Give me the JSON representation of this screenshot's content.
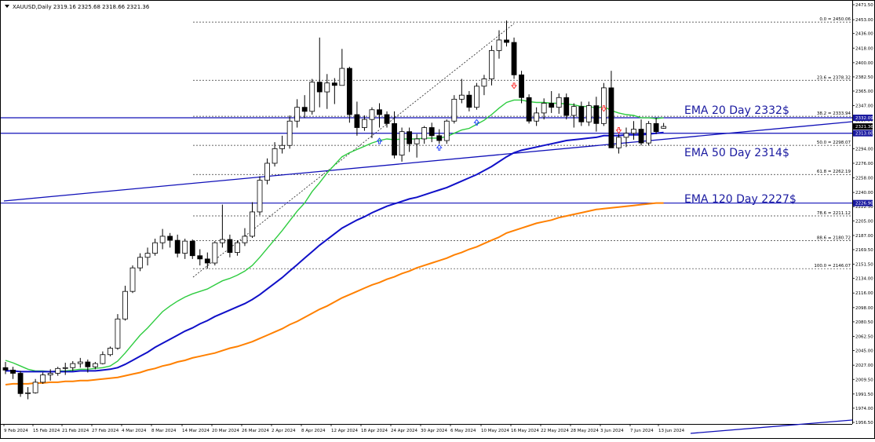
{
  "chart_data": {
    "type": "candlestick",
    "symbol_header": "XAUUSD,Daily  2319.16 2325.68 2318.66 2321.36",
    "y_ticks": [
      "2471.50",
      "2453.00",
      "2436.00",
      "2418.00",
      "2400.00",
      "2382.50",
      "2365.00",
      "2347.00",
      "2329.50",
      "2312.00",
      "2294.00",
      "2276.00",
      "2258.00",
      "2240.00",
      "2222.50",
      "2205.00",
      "2187.00",
      "2169.50",
      "2151.50",
      "2134.00",
      "2116.00",
      "2098.00",
      "2080.50",
      "2062.50",
      "2045.00",
      "2027.00",
      "2009.50",
      "1991.50",
      "1974.00",
      "1956.50"
    ],
    "x_ticks": [
      "9 Feb 2024",
      "15 Feb 2024",
      "21 Feb 2024",
      "27 Feb 2024",
      "4 Mar 2024",
      "8 Mar 2024",
      "14 Mar 2024",
      "20 Mar 2024",
      "26 Mar 2024",
      "2 Apr 2024",
      "8 Apr 2024",
      "12 Apr 2024",
      "18 Apr 2024",
      "24 Apr 2024",
      "30 Apr 2024",
      "6 May 2024",
      "10 May 2024",
      "16 May 2024",
      "22 May 2024",
      "28 May 2024",
      "3 Jun 2024",
      "7 Jun 2024",
      "13 Jun 2024"
    ],
    "price_tags": [
      {
        "text": "2332.09",
        "value": 2332.09,
        "bg": "#1a1aa0"
      },
      {
        "text": "2321.36",
        "value": 2321.36,
        "bg": "#000000"
      },
      {
        "text": "2313.00",
        "value": 2313.0,
        "bg": "#1a1aa0"
      },
      {
        "text": "2226.90",
        "value": 2226.9,
        "bg": "#1a1aa0"
      }
    ],
    "fib_levels": [
      {
        "label": "0.0 = 2450.06",
        "value": 2450.06
      },
      {
        "label": "23.6 = 2378.32",
        "value": 2378.32
      },
      {
        "label": "38.2 = 2333.94",
        "value": 2333.94
      },
      {
        "label": "50.0 = 2298.07",
        "value": 2298.07
      },
      {
        "label": "61.8 = 2262.19",
        "value": 2262.19
      },
      {
        "label": "78.6 = 2211.12",
        "value": 2211.12
      },
      {
        "label": "88.6 = 2180.72",
        "value": 2180.72
      },
      {
        "label": "100.0 = 2146.07",
        "value": 2146.07
      }
    ],
    "horizontal_lines": [
      2332.09,
      2313.0,
      2226.9
    ],
    "annotations": [
      {
        "text": "EMA 20 Day  2332$"
      },
      {
        "text": "EMA 50 Day  2314$"
      },
      {
        "text": "EMA 120 Day  2227$"
      }
    ],
    "candles": [
      [
        2024,
        2031,
        2016,
        2021
      ],
      [
        2021,
        2025,
        2010,
        2017
      ],
      [
        2017,
        2020,
        1988,
        1992
      ],
      [
        1992,
        2000,
        1985,
        1993
      ],
      [
        1993,
        2010,
        1992,
        2006
      ],
      [
        2006,
        2018,
        2004,
        2015
      ],
      [
        2015,
        2022,
        2008,
        2017
      ],
      [
        2017,
        2025,
        2014,
        2023
      ],
      [
        2023,
        2030,
        2015,
        2024
      ],
      [
        2024,
        2032,
        2020,
        2029
      ],
      [
        2029,
        2036,
        2024,
        2031
      ],
      [
        2031,
        2034,
        2018,
        2025
      ],
      [
        2025,
        2031,
        2022,
        2029
      ],
      [
        2029,
        2044,
        2028,
        2040
      ],
      [
        2040,
        2050,
        2038,
        2048
      ],
      [
        2048,
        2090,
        2046,
        2084
      ],
      [
        2084,
        2125,
        2082,
        2118
      ],
      [
        2118,
        2150,
        2116,
        2147
      ],
      [
        2147,
        2165,
        2143,
        2160
      ],
      [
        2160,
        2172,
        2150,
        2165
      ],
      [
        2165,
        2183,
        2162,
        2178
      ],
      [
        2178,
        2195,
        2170,
        2186
      ],
      [
        2186,
        2190,
        2172,
        2181
      ],
      [
        2181,
        2188,
        2160,
        2165
      ],
      [
        2165,
        2183,
        2158,
        2180
      ],
      [
        2180,
        2182,
        2158,
        2162
      ],
      [
        2162,
        2170,
        2150,
        2158
      ],
      [
        2158,
        2166,
        2146,
        2153
      ],
      [
        2153,
        2180,
        2150,
        2178
      ],
      [
        2178,
        2225,
        2172,
        2182
      ],
      [
        2182,
        2188,
        2160,
        2166
      ],
      [
        2166,
        2181,
        2162,
        2178
      ],
      [
        2178,
        2196,
        2174,
        2186
      ],
      [
        2186,
        2228,
        2184,
        2216
      ],
      [
        2216,
        2260,
        2212,
        2255
      ],
      [
        2255,
        2282,
        2250,
        2276
      ],
      [
        2276,
        2302,
        2272,
        2294
      ],
      [
        2294,
        2310,
        2288,
        2298
      ],
      [
        2298,
        2335,
        2294,
        2328
      ],
      [
        2328,
        2355,
        2320,
        2345
      ],
      [
        2345,
        2360,
        2332,
        2340
      ],
      [
        2340,
        2380,
        2336,
        2376
      ],
      [
        2376,
        2431,
        2345,
        2364
      ],
      [
        2364,
        2386,
        2343,
        2375
      ],
      [
        2375,
        2381,
        2349,
        2372
      ],
      [
        2372,
        2417,
        2372,
        2393
      ],
      [
        2393,
        2395,
        2326,
        2336
      ],
      [
        2336,
        2352,
        2310,
        2320
      ],
      [
        2320,
        2335,
        2316,
        2330
      ],
      [
        2330,
        2345,
        2307,
        2342
      ],
      [
        2342,
        2350,
        2320,
        2336
      ],
      [
        2336,
        2340,
        2320,
        2325
      ],
      [
        2325,
        2340,
        2282,
        2286
      ],
      [
        2286,
        2320,
        2278,
        2315
      ],
      [
        2315,
        2320,
        2290,
        2300
      ],
      [
        2300,
        2312,
        2283,
        2306
      ],
      [
        2306,
        2322,
        2300,
        2320
      ],
      [
        2320,
        2326,
        2302,
        2310
      ],
      [
        2310,
        2318,
        2300,
        2304
      ],
      [
        2304,
        2330,
        2300,
        2328
      ],
      [
        2328,
        2360,
        2325,
        2355
      ],
      [
        2355,
        2380,
        2350,
        2360
      ],
      [
        2360,
        2365,
        2340,
        2345
      ],
      [
        2345,
        2375,
        2342,
        2371
      ],
      [
        2371,
        2385,
        2360,
        2380
      ],
      [
        2380,
        2421,
        2372,
        2415
      ],
      [
        2415,
        2440,
        2405,
        2428
      ],
      [
        2428,
        2452,
        2420,
        2425
      ],
      [
        2425,
        2431,
        2380,
        2385
      ],
      [
        2385,
        2390,
        2350,
        2357
      ],
      [
        2357,
        2361,
        2325,
        2328
      ],
      [
        2328,
        2345,
        2322,
        2338
      ],
      [
        2338,
        2356,
        2330,
        2350
      ],
      [
        2350,
        2365,
        2338,
        2345
      ],
      [
        2345,
        2362,
        2337,
        2357
      ],
      [
        2357,
        2362,
        2330,
        2335
      ],
      [
        2335,
        2350,
        2320,
        2346
      ],
      [
        2346,
        2352,
        2322,
        2327
      ],
      [
        2327,
        2352,
        2322,
        2347
      ],
      [
        2347,
        2358,
        2315,
        2325
      ],
      [
        2325,
        2375,
        2322,
        2369
      ],
      [
        2369,
        2390,
        2310,
        2295
      ],
      [
        2295,
        2312,
        2288,
        2308
      ],
      [
        2308,
        2320,
        2296,
        2313
      ],
      [
        2313,
        2328,
        2305,
        2318
      ],
      [
        2318,
        2330,
        2298,
        2301
      ],
      [
        2301,
        2328,
        2298,
        2325
      ],
      [
        2325,
        2332,
        2312,
        2315
      ],
      [
        2319.16,
        2325.68,
        2318.66,
        2321.36
      ]
    ],
    "ema_lines": [
      {
        "name": "EMA 20",
        "color": "#2ecc40",
        "values": [
          2033,
          2030,
          2026,
          2022,
          2020,
          2020,
          2019,
          2020,
          2020,
          2021,
          2022,
          2022,
          2023,
          2024,
          2026,
          2032,
          2042,
          2053,
          2064,
          2073,
          2083,
          2093,
          2100,
          2106,
          2111,
          2115,
          2118,
          2121,
          2126,
          2131,
          2134,
          2138,
          2143,
          2150,
          2160,
          2171,
          2182,
          2193,
          2205,
          2217,
          2227,
          2241,
          2252,
          2264,
          2274,
          2284,
          2289,
          2293,
          2297,
          2301,
          2304,
          2306,
          2305,
          2306,
          2306,
          2306,
          2307,
          2307,
          2307,
          2309,
          2313,
          2317,
          2319,
          2324,
          2329,
          2336,
          2344,
          2351,
          2354,
          2354,
          2352,
          2351,
          2351,
          2350,
          2350,
          2349,
          2348,
          2346,
          2346,
          2344,
          2346,
          2341,
          2338,
          2336,
          2335,
          2332,
          2332,
          2331,
          2332
        ]
      },
      {
        "name": "EMA 50",
        "color": "#1010c8",
        "values": [
          2020,
          2020,
          2019,
          2019,
          2019,
          2019,
          2019,
          2019,
          2019,
          2019,
          2020,
          2020,
          2020,
          2021,
          2022,
          2024,
          2028,
          2033,
          2038,
          2043,
          2049,
          2054,
          2059,
          2064,
          2069,
          2073,
          2078,
          2082,
          2087,
          2091,
          2095,
          2099,
          2103,
          2108,
          2114,
          2121,
          2128,
          2135,
          2143,
          2151,
          2159,
          2167,
          2175,
          2182,
          2189,
          2196,
          2201,
          2206,
          2210,
          2215,
          2219,
          2223,
          2226,
          2229,
          2232,
          2234,
          2237,
          2240,
          2243,
          2246,
          2250,
          2254,
          2258,
          2262,
          2267,
          2272,
          2278,
          2284,
          2289,
          2292,
          2294,
          2296,
          2298,
          2300,
          2302,
          2304,
          2305,
          2306,
          2307,
          2308,
          2310,
          2310,
          2310,
          2311,
          2311,
          2311,
          2312,
          2313,
          2314
        ]
      },
      {
        "name": "EMA 120",
        "color": "#ff8000",
        "values": [
          2003,
          2004,
          2004,
          2004,
          2005,
          2005,
          2006,
          2006,
          2007,
          2007,
          2008,
          2008,
          2009,
          2010,
          2011,
          2012,
          2014,
          2016,
          2018,
          2021,
          2023,
          2026,
          2028,
          2031,
          2033,
          2036,
          2038,
          2040,
          2042,
          2045,
          2048,
          2050,
          2053,
          2056,
          2060,
          2064,
          2068,
          2072,
          2077,
          2081,
          2086,
          2091,
          2096,
          2100,
          2105,
          2110,
          2114,
          2118,
          2122,
          2126,
          2129,
          2133,
          2136,
          2140,
          2143,
          2147,
          2150,
          2153,
          2156,
          2159,
          2163,
          2166,
          2170,
          2173,
          2177,
          2181,
          2185,
          2190,
          2193,
          2196,
          2199,
          2202,
          2204,
          2206,
          2209,
          2211,
          2213,
          2215,
          2217,
          2219,
          2220,
          2221,
          2222,
          2223,
          2224,
          2225,
          2226,
          2227,
          2227
        ]
      }
    ],
    "markers": [
      {
        "type": "up",
        "index": 50,
        "price": 2303
      },
      {
        "type": "up",
        "index": 58,
        "price": 2295
      },
      {
        "type": "up",
        "index": 63,
        "price": 2326
      },
      {
        "type": "down",
        "index": 68,
        "price": 2372
      },
      {
        "type": "down",
        "index": 80,
        "price": 2344
      },
      {
        "type": "down",
        "index": 82,
        "price": 2317
      }
    ]
  }
}
